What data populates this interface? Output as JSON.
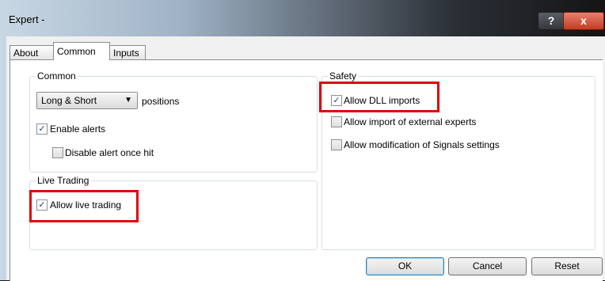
{
  "window": {
    "title": "Expert -",
    "help_glyph": "?",
    "close_glyph": "x"
  },
  "tabs": [
    {
      "label": "About",
      "active": false
    },
    {
      "label": "Common",
      "active": true
    },
    {
      "label": "Inputs",
      "active": false
    }
  ],
  "common": {
    "group_label": "Common",
    "positions_select": {
      "value": "Long & Short",
      "suffix": "positions"
    },
    "enable_alerts": {
      "label": "Enable alerts",
      "checked": true
    },
    "disable_alert": {
      "label": "Disable alert once hit",
      "checked": false
    }
  },
  "live_trading": {
    "group_label": "Live Trading",
    "allow_live": {
      "label": "Allow live trading",
      "checked": true
    }
  },
  "safety": {
    "group_label": "Safety",
    "allow_dll": {
      "label": "Allow DLL imports",
      "checked": true
    },
    "allow_external": {
      "label": "Allow import of external experts",
      "checked": false
    },
    "allow_signals": {
      "label": "Allow modification of Signals settings",
      "checked": false
    }
  },
  "buttons": {
    "ok": "OK",
    "cancel": "Cancel",
    "reset": "Reset"
  },
  "colors": {
    "highlight": "#e1000a",
    "check": "#1d3f8c"
  }
}
